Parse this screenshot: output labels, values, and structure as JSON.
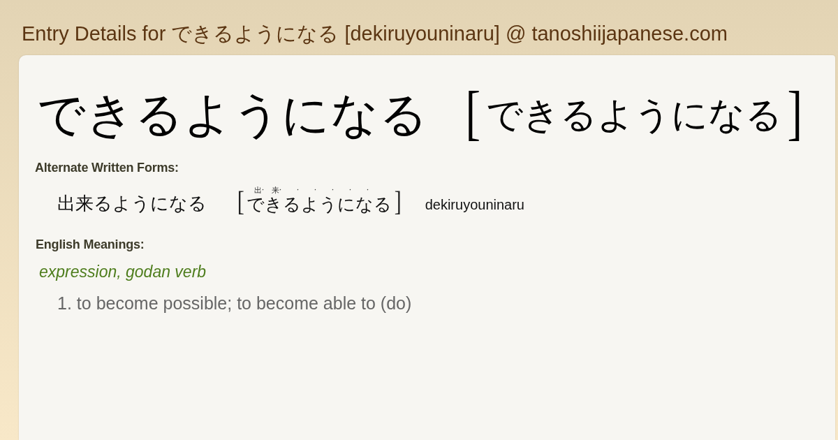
{
  "page_title": "Entry Details for できるようになる [dekiruyouninaru] @ tanoshiijapanese.com",
  "entry": {
    "headword": "できるようになる",
    "brackets": [
      "[",
      "]"
    ],
    "reading": "できるようになる"
  },
  "alternate_forms": {
    "heading": "Alternate Written Forms:",
    "forms": [
      {
        "written": "出来るようになる",
        "brackets": [
          "[",
          "]"
        ],
        "furigana": [
          "出·",
          "来·",
          "·",
          "·",
          "·",
          "·",
          "·"
        ],
        "reading": "できるようになる",
        "romaji": "dekiruyouninaru"
      }
    ]
  },
  "meanings": {
    "heading": "English Meanings:",
    "groups": [
      {
        "part_of_speech": "expression, godan verb",
        "senses": [
          {
            "number": "1.",
            "text": "to become possible; to become able to (do)"
          }
        ]
      }
    ]
  }
}
